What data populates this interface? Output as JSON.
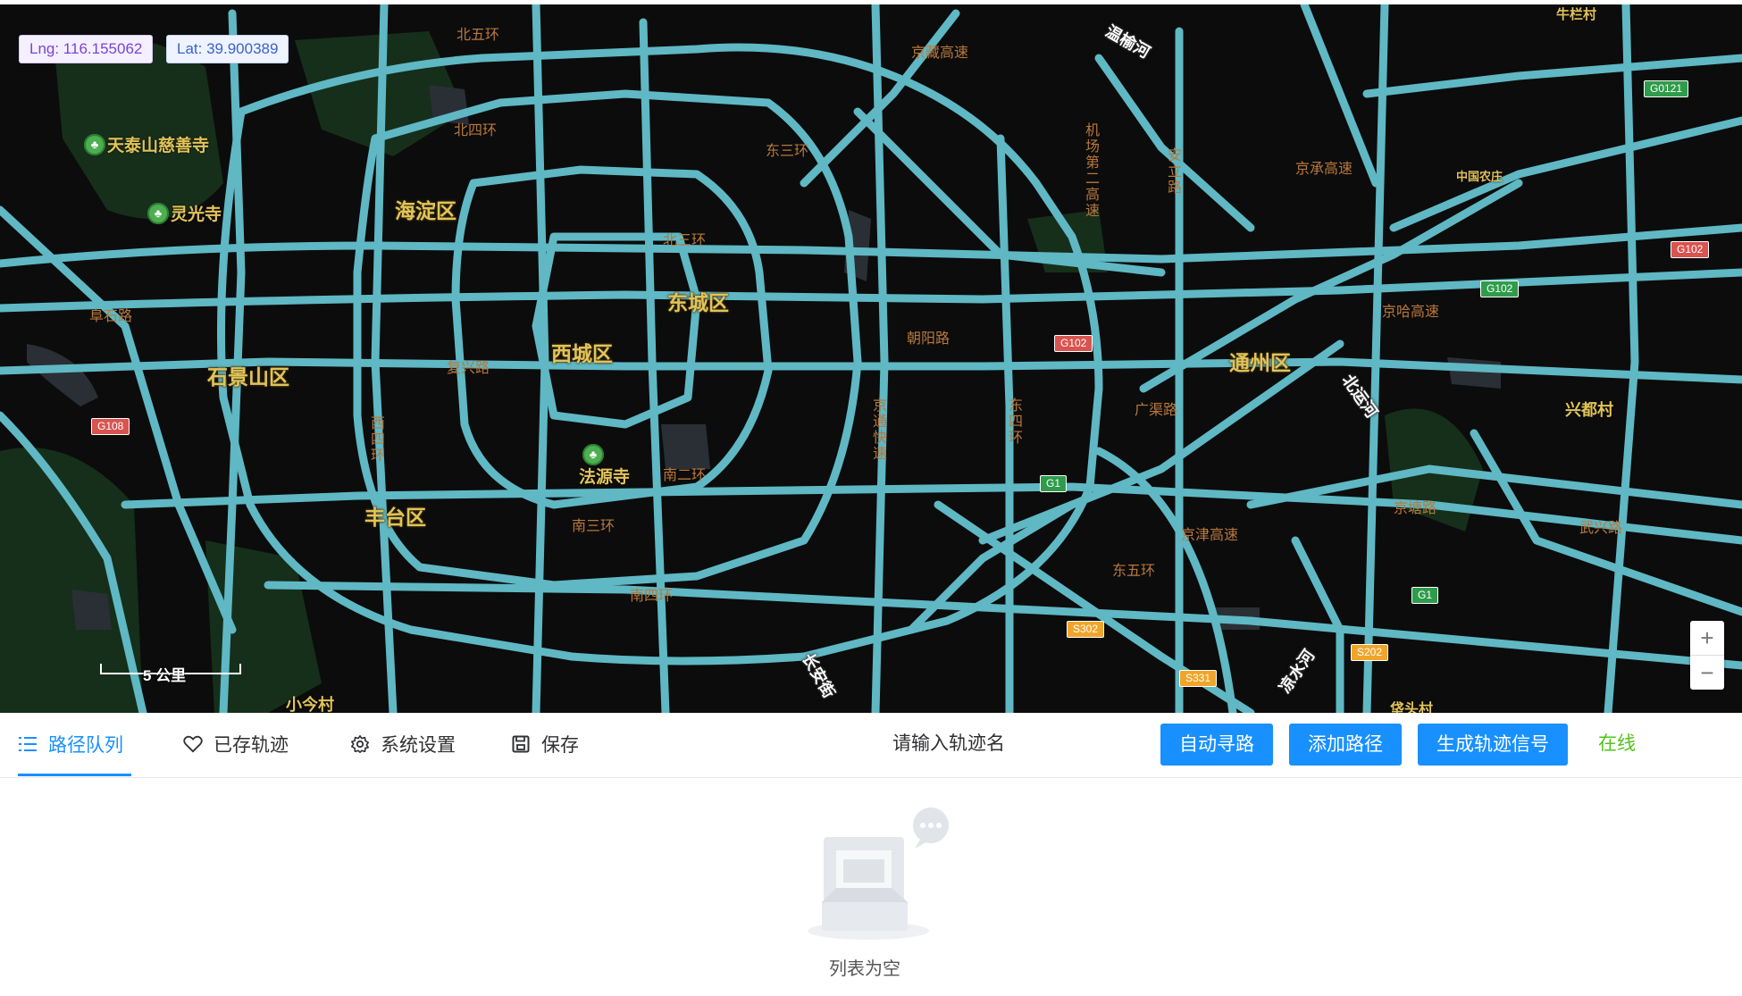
{
  "map": {
    "lng_text": "Lng: 116.155062",
    "lat_text": "Lat: 39.900389",
    "districts": [
      "海淀区",
      "东城区",
      "西城区",
      "石景山区",
      "丰台区",
      "通州区"
    ],
    "road_labels": [
      "北四环",
      "北三环",
      "朝阳路",
      "阜石路",
      "复兴路",
      "南二环",
      "南四环",
      "广渠路",
      "京塘路",
      "武兴路",
      "京哈高速",
      "京藏高速",
      "南三环",
      "东四环",
      "东五环",
      "京津高速",
      "京通快速",
      "西四环",
      "东三环",
      "京承高速",
      "北五环",
      "机场第二高速",
      "安立路"
    ],
    "places": [
      "兴都村",
      "小今村",
      "中国农庄",
      "牛栏村",
      "垡头村"
    ],
    "pois": [
      "天泰山慈善寺",
      "灵光寺",
      "法源寺"
    ],
    "rivers": [
      "温榆河",
      "北运河",
      "凉水河",
      "长安街"
    ],
    "shields": [
      "G108",
      "G102",
      "G102",
      "G0121",
      "G102",
      "G1",
      "G1",
      "S302",
      "S331",
      "S202"
    ],
    "scale_label": "5 公里",
    "zoom_in": "+",
    "zoom_out": "−"
  },
  "toolbar": {
    "tabs": [
      {
        "label": "路径队列",
        "icon": "list-icon"
      },
      {
        "label": "已存轨迹",
        "icon": "heart-icon"
      },
      {
        "label": "系统设置",
        "icon": "gear-icon"
      },
      {
        "label": "保存",
        "icon": "save-icon"
      }
    ],
    "track_name_placeholder": "请输入轨迹名",
    "buttons": {
      "auto_route": "自动寻路",
      "add_path": "添加路径",
      "generate_signal": "生成轨迹信号"
    },
    "status": "在线"
  },
  "queue": {
    "empty_text": "列表为空"
  },
  "colors": {
    "primary": "#1890ff",
    "online": "#52c41a",
    "road": "#5fb8c4",
    "map_bg": "#0c0c0c",
    "district_label": "#e2c35a"
  }
}
